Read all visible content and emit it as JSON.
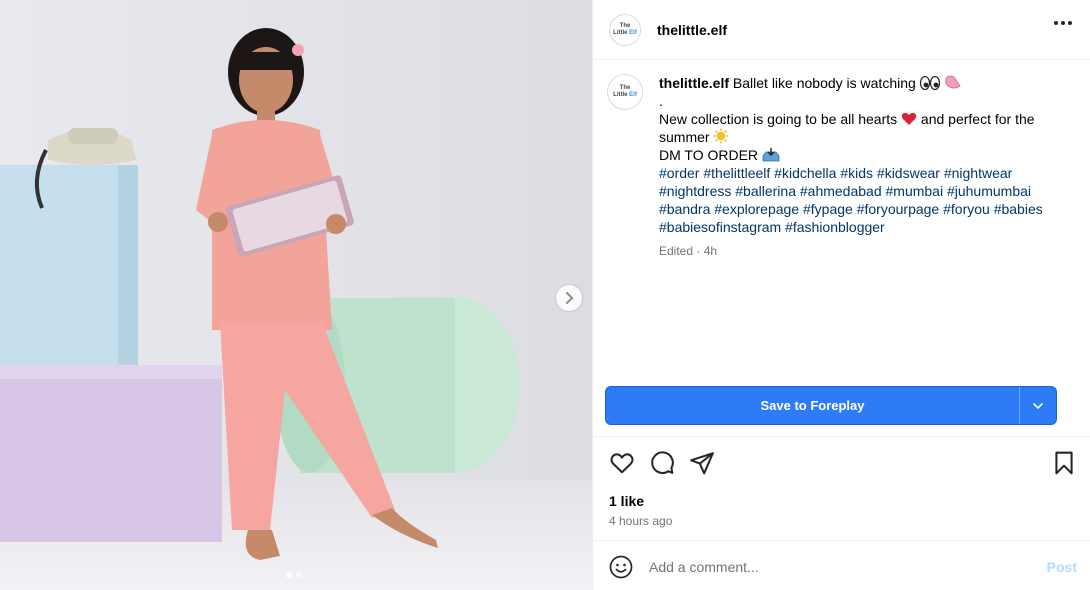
{
  "post": {
    "username": "thelittle.elf",
    "avatar_text": {
      "line1": "The",
      "line2a": "Little",
      "line2b": "Elf"
    },
    "caption": {
      "username": "thelittle.elf",
      "line1": "Ballet like nobody is watching",
      "line1_emojis": [
        "eyes-emoji",
        "ballet-shoe-emoji"
      ],
      "line2": ".",
      "line3a": "New collection is going to be all hearts",
      "line3_emoji": "red-heart-emoji",
      "line3b": "and perfect for the",
      "line4": "summer",
      "line4_emoji": "sun-emoji",
      "line5": "DM TO ORDER",
      "line5_emoji": "inbox-tray-emoji",
      "hashtags": [
        "#order #thelittleelf #kidchella #kids #kidswear #nightwear",
        "#nightdress #ballerina #ahmedabad #mumbai #juhumumbai",
        "#bandra #explorepage #fypage #foryourpage #foryou #babies",
        "#babiesofinstagram #fashionblogger"
      ]
    },
    "edited": "Edited · 4h",
    "likes": "1 like",
    "time_ago": "4 hours ago"
  },
  "extension": {
    "save_label": "Save to Foreplay"
  },
  "comment": {
    "placeholder": "Add a comment...",
    "post_label": "Post"
  },
  "carousel": {
    "count": 2,
    "active": 0
  },
  "colors": {
    "hashtag": "#00376b",
    "save_button": "#2d7bf6",
    "post_disabled": "#b3dbff",
    "muted": "#737373"
  },
  "icons": [
    "more-options-icon",
    "chevron-right-icon",
    "heart-icon",
    "comment-icon",
    "share-icon",
    "bookmark-icon",
    "emoji-icon",
    "chevron-down-icon"
  ]
}
